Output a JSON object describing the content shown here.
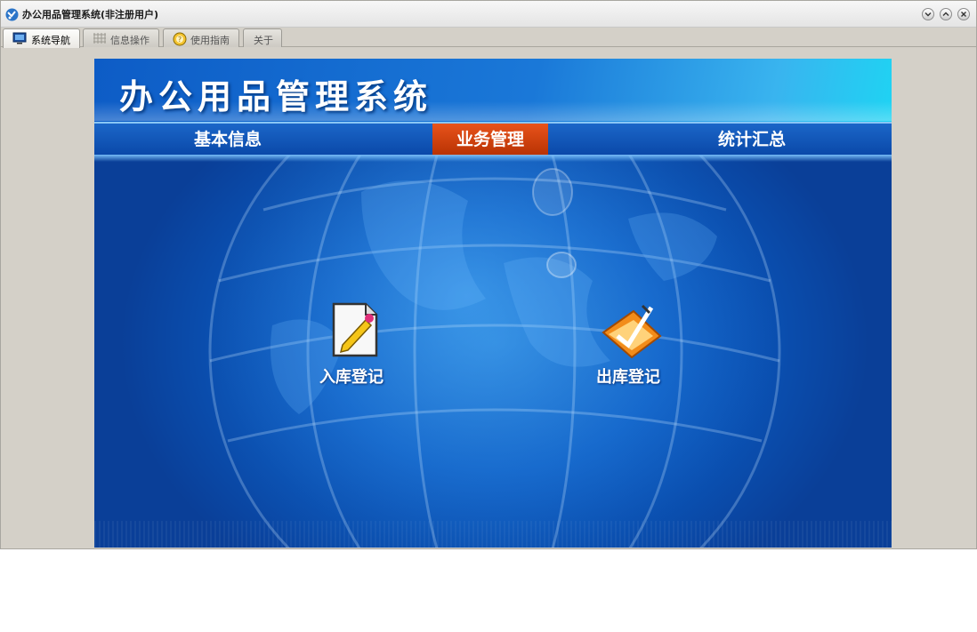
{
  "window": {
    "title": "办公用品管理系统(非注册用户)"
  },
  "tabs": [
    {
      "label": "系统导航",
      "icon": "monitor-icon"
    },
    {
      "label": "信息操作",
      "icon": "grid-icon"
    },
    {
      "label": "使用指南",
      "icon": "help-icon"
    },
    {
      "label": "关于"
    }
  ],
  "header": {
    "title": "办公用品管理系统"
  },
  "nav": {
    "items": [
      "基本信息",
      "业务管理",
      "统计汇总"
    ],
    "active": "业务管理"
  },
  "functions": [
    {
      "label": "入库登记",
      "icon": "document-pencil-icon"
    },
    {
      "label": "出库登记",
      "icon": "folder-check-icon"
    }
  ],
  "colors": {
    "active_nav": "#d8420f",
    "background": "#1368cf"
  }
}
